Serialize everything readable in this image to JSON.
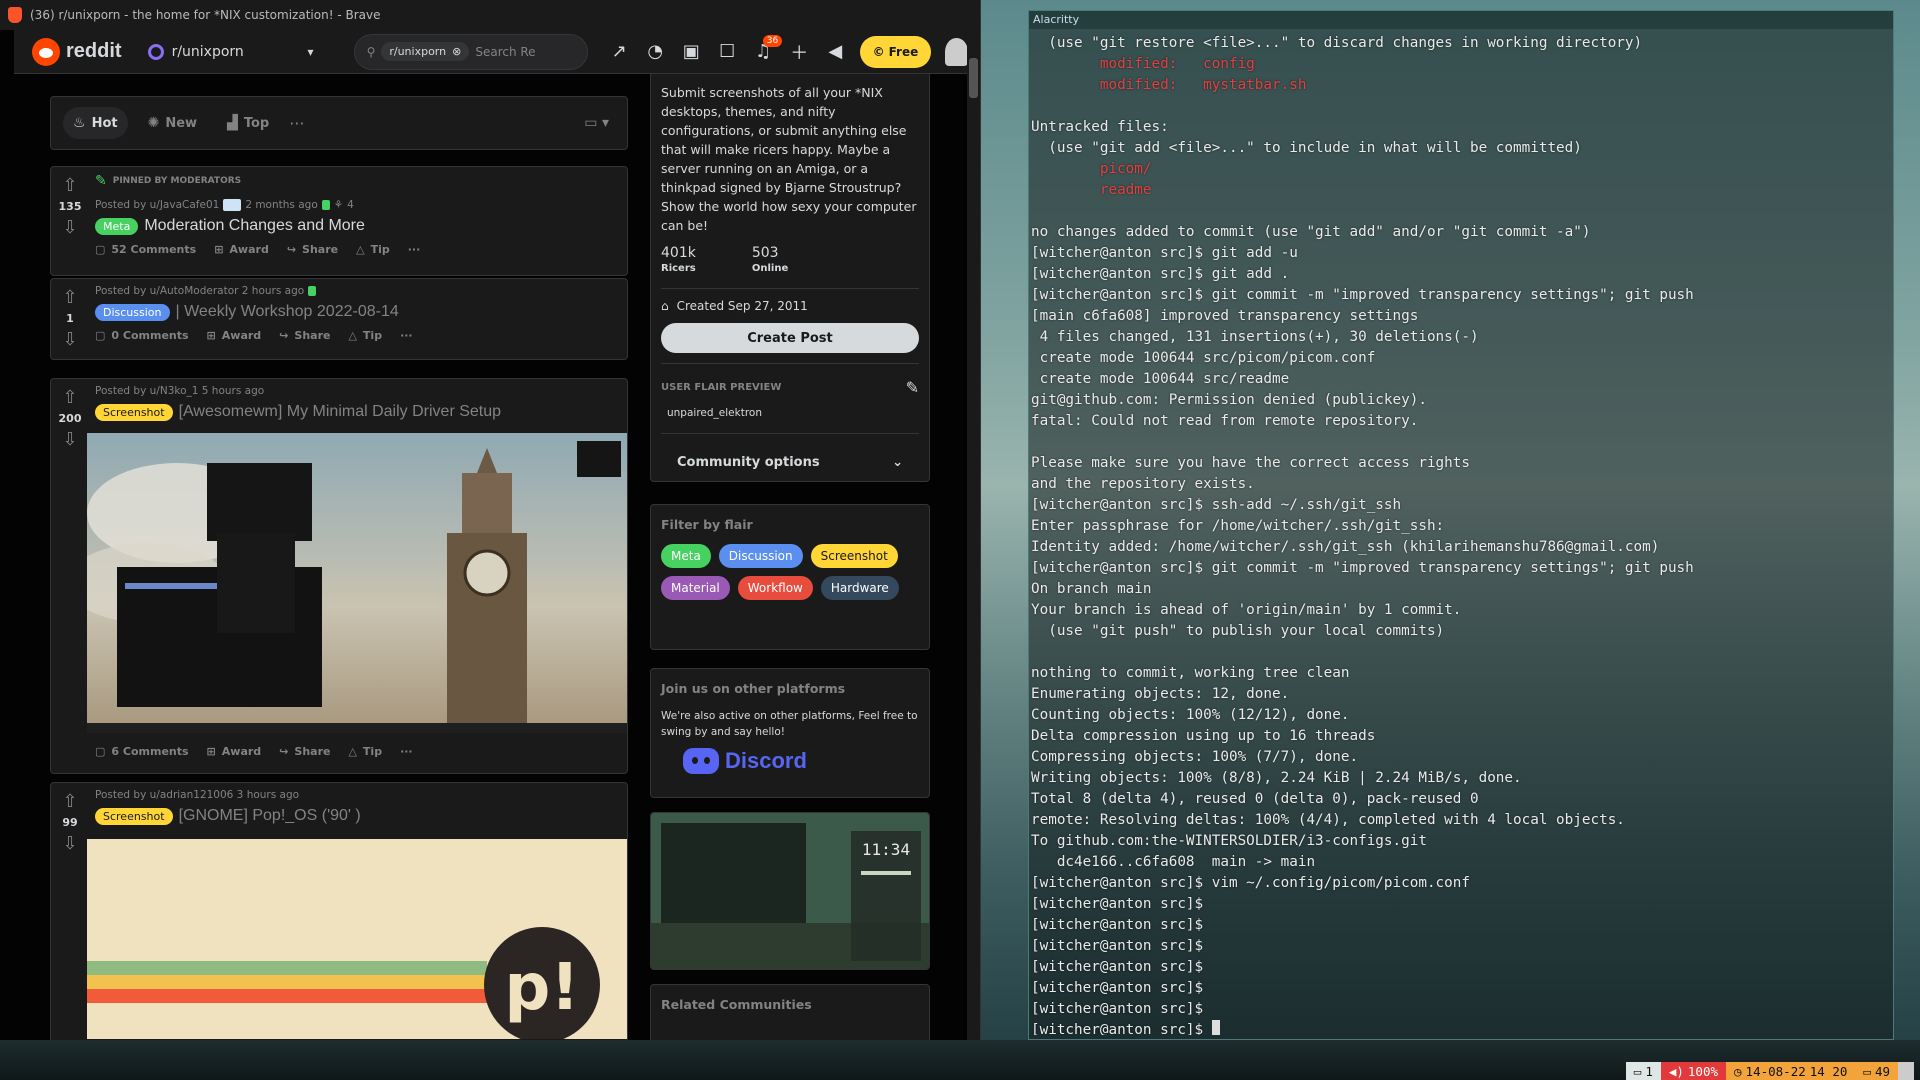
{
  "browser": {
    "title": "(36) r/unixporn - the home for *NIX customization! - Brave"
  },
  "header": {
    "logo_text": "reddit",
    "subreddit": "r/unixporn",
    "search_chip": "r/unixporn",
    "search_placeholder": "Search Re",
    "notification_count": "36",
    "free_label": "Free"
  },
  "sort": {
    "hot": "Hot",
    "new": "New",
    "top": "Top",
    "more": "···"
  },
  "posts": [
    {
      "pinned_label": "PINNED BY MODERATORS",
      "votes": "135",
      "meta": "Posted by u/JavaCafe01",
      "time": "2 months ago",
      "award_count": "4",
      "flair": "Meta",
      "title": "Moderation Changes and More",
      "comments": "52 Comments",
      "award": "Award",
      "share": "Share",
      "tip": "Tip"
    },
    {
      "votes": "1",
      "meta": "Posted by u/AutoModerator 2 hours ago",
      "flair": "Discussion",
      "title": "| Weekly Workshop 2022-08-14",
      "comments": "0 Comments",
      "award": "Award",
      "share": "Share",
      "tip": "Tip"
    },
    {
      "votes": "200",
      "meta": "Posted by u/N3ko_1 5 hours ago",
      "flair": "Screenshot",
      "title": "[Awesomewm] My Minimal Daily Driver Setup",
      "comments": "6 Comments",
      "award": "Award",
      "share": "Share",
      "tip": "Tip"
    },
    {
      "votes": "99",
      "meta": "Posted by u/adrian121006 3 hours ago",
      "flair": "Screenshot",
      "title": "[GNOME] Pop!_OS ('90' )"
    }
  ],
  "sidebar": {
    "about": "Submit screenshots of all your *NIX desktops, themes, and nifty configurations, or submit anything else that will make ricers happy. Maybe a server running on an Amiga, or a thinkpad signed by Bjarne Stroustrup? Show the world how sexy your computer can be!",
    "members": "401k",
    "members_label": "Ricers",
    "online": "503",
    "online_label": "Online",
    "created": "Created Sep 27, 2011",
    "create_post": "Create Post",
    "user_flair_title": "USER FLAIR PREVIEW",
    "user_flair": "unpaired_elektron",
    "community_options": "Community options",
    "filter_title": "Filter by flair",
    "flairs": [
      "Meta",
      "Discussion",
      "Screenshot",
      "Material",
      "Workflow",
      "Hardware"
    ],
    "join_title": "Join us on other platforms",
    "join_text": "We're also active on other platforms, Feel free to swing by and say hello!",
    "discord": "Discord",
    "preview_clock": "11:34",
    "related_title": "Related Communities"
  },
  "colors": {
    "flair_meta": "#46d160",
    "flair_discussion": "#5a8ff0",
    "flair_screenshot": "#ffd635",
    "flair_material": "#9b59b6",
    "flair_workflow": "#e74c3c",
    "flair_hardware": "#34495e"
  },
  "terminal": {
    "title": "Alacritty",
    "lines": [
      {
        "text": "  (use \"git restore <file>...\" to discard changes in working directory)",
        "red": false
      },
      {
        "text": "        modified:   config",
        "red": true
      },
      {
        "text": "        modified:   mystatbar.sh",
        "red": true
      },
      {
        "text": "",
        "red": false
      },
      {
        "text": "Untracked files:",
        "red": false
      },
      {
        "text": "  (use \"git add <file>...\" to include in what will be committed)",
        "red": false
      },
      {
        "text": "        picom/",
        "red": true
      },
      {
        "text": "        readme",
        "red": true
      },
      {
        "text": "",
        "red": false
      },
      {
        "text": "no changes added to commit (use \"git add\" and/or \"git commit -a\")",
        "red": false
      },
      {
        "text": "[witcher@anton src]$ git add -u",
        "red": false
      },
      {
        "text": "[witcher@anton src]$ git add .",
        "red": false
      },
      {
        "text": "[witcher@anton src]$ git commit -m \"improved transparency settings\"; git push",
        "red": false
      },
      {
        "text": "[main c6fa608] improved transparency settings",
        "red": false
      },
      {
        "text": " 4 files changed, 131 insertions(+), 30 deletions(-)",
        "red": false
      },
      {
        "text": " create mode 100644 src/picom/picom.conf",
        "red": false
      },
      {
        "text": " create mode 100644 src/readme",
        "red": false
      },
      {
        "text": "git@github.com: Permission denied (publickey).",
        "red": false
      },
      {
        "text": "fatal: Could not read from remote repository.",
        "red": false
      },
      {
        "text": "",
        "red": false
      },
      {
        "text": "Please make sure you have the correct access rights",
        "red": false
      },
      {
        "text": "and the repository exists.",
        "red": false
      },
      {
        "text": "[witcher@anton src]$ ssh-add ~/.ssh/git_ssh",
        "red": false
      },
      {
        "text": "Enter passphrase for /home/witcher/.ssh/git_ssh:",
        "red": false
      },
      {
        "text": "Identity added: /home/witcher/.ssh/git_ssh (khilarihemanshu786@gmail.com)",
        "red": false
      },
      {
        "text": "[witcher@anton src]$ git commit -m \"improved transparency settings\"; git push",
        "red": false
      },
      {
        "text": "On branch main",
        "red": false
      },
      {
        "text": "Your branch is ahead of 'origin/main' by 1 commit.",
        "red": false
      },
      {
        "text": "  (use \"git push\" to publish your local commits)",
        "red": false
      },
      {
        "text": "",
        "red": false
      },
      {
        "text": "nothing to commit, working tree clean",
        "red": false
      },
      {
        "text": "Enumerating objects: 12, done.",
        "red": false
      },
      {
        "text": "Counting objects: 100% (12/12), done.",
        "red": false
      },
      {
        "text": "Delta compression using up to 16 threads",
        "red": false
      },
      {
        "text": "Compressing objects: 100% (7/7), done.",
        "red": false
      },
      {
        "text": "Writing objects: 100% (8/8), 2.24 KiB | 2.24 MiB/s, done.",
        "red": false
      },
      {
        "text": "Total 8 (delta 4), reused 0 (delta 0), pack-reused 0",
        "red": false
      },
      {
        "text": "remote: Resolving deltas: 100% (4/4), completed with 4 local objects.",
        "red": false
      },
      {
        "text": "To github.com:the-WINTERSOLDIER/i3-configs.git",
        "red": false
      },
      {
        "text": "   dc4e166..c6fa608  main -> main",
        "red": false
      },
      {
        "text": "[witcher@anton src]$ vim ~/.config/picom/picom.conf",
        "red": false
      },
      {
        "text": "[witcher@anton src]$",
        "red": false
      },
      {
        "text": "[witcher@anton src]$",
        "red": false
      },
      {
        "text": "[witcher@anton src]$",
        "red": false
      },
      {
        "text": "[witcher@anton src]$",
        "red": false
      },
      {
        "text": "[witcher@anton src]$",
        "red": false
      },
      {
        "text": "[witcher@anton src]$",
        "red": false
      }
    ],
    "prompt": "[witcher@anton src]$ "
  },
  "statusbar": {
    "workspace": "1",
    "volume": "100%",
    "date": "14-08-22",
    "time": "14 20",
    "battery": "49"
  }
}
